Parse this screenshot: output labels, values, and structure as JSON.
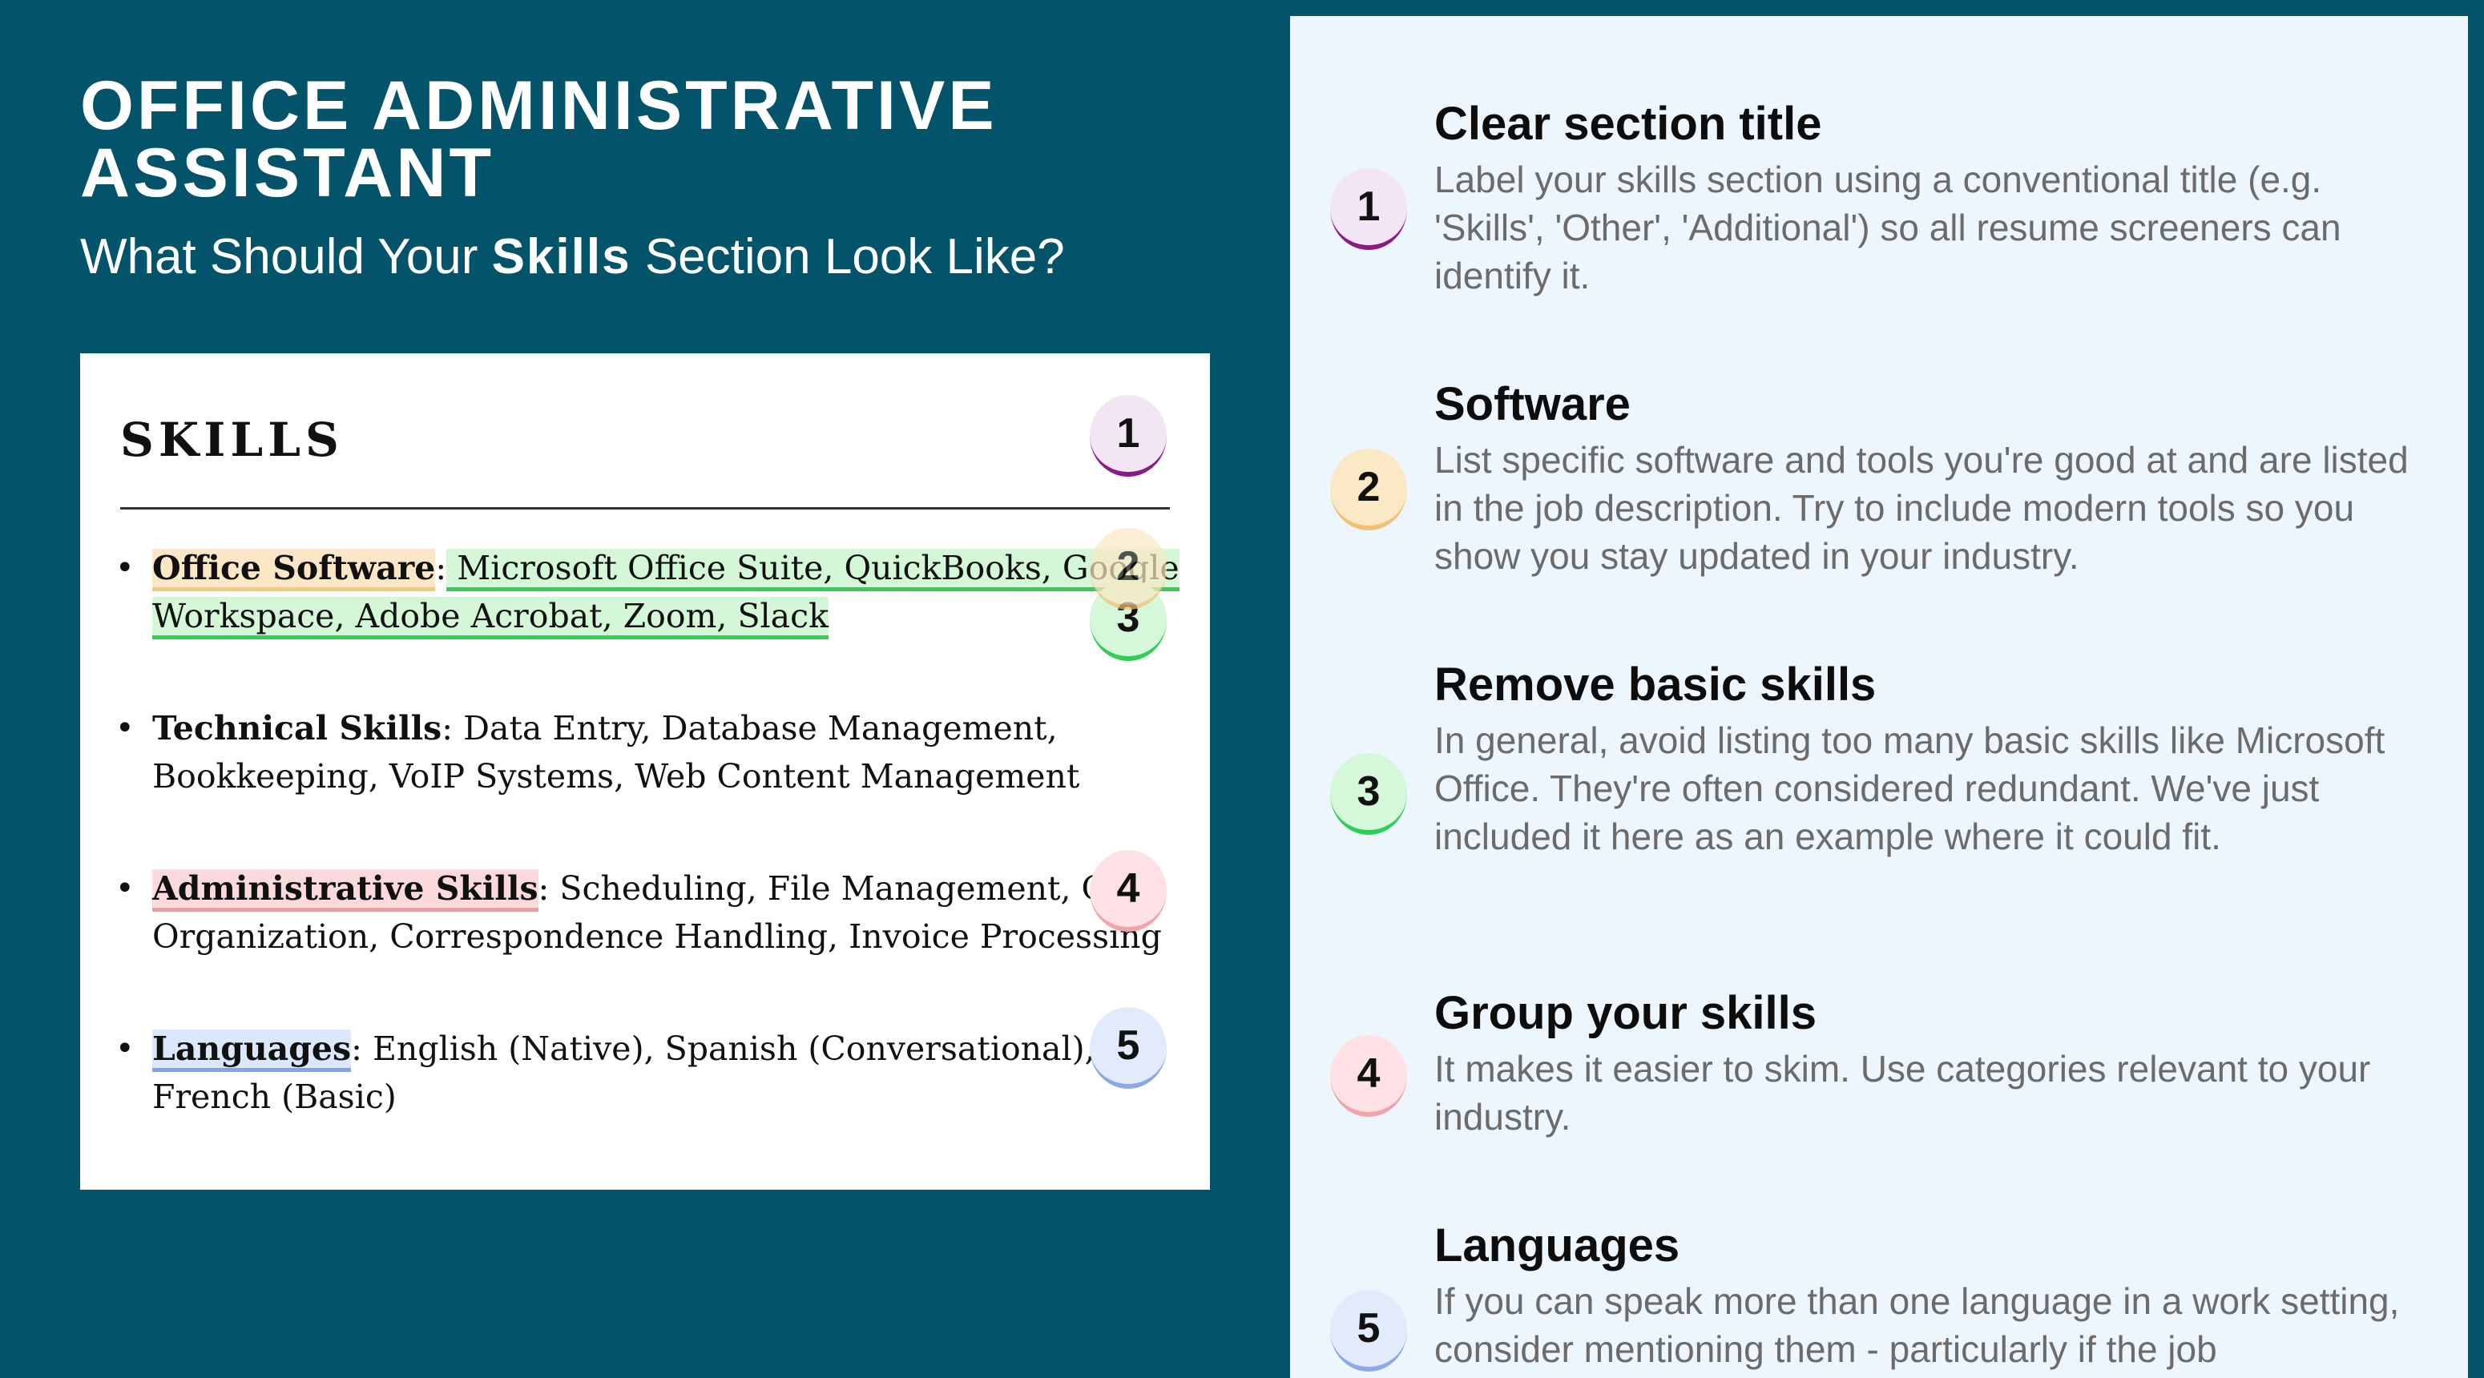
{
  "header": {
    "title_line1": "OFFICE ADMINISTRATIVE",
    "title_line2": "ASSISTANT",
    "subtitle_prefix": "What Should Your ",
    "subtitle_bold": "Skills",
    "subtitle_suffix": " Section Look Like?"
  },
  "card": {
    "heading": "SKILLS",
    "bullet": "•",
    "skills": [
      {
        "category": "Office Software",
        "sep": ":",
        "line1": " Microsoft Office Suite, QuickBooks, Google",
        "line2": "Workspace, Adobe Acrobat, Zoom, Slack"
      },
      {
        "category": "Technical Skills",
        "sep": ":",
        "line1": " Data Entry, Database Management,",
        "line2": "Bookkeeping, VoIP Systems, Web Content Management"
      },
      {
        "category": "Administrative Skills",
        "sep": ":",
        "line1": " Scheduling, File Management, O",
        "line2": "Organization, Correspondence Handling, Invoice Processing"
      },
      {
        "category": "Languages",
        "sep": ":",
        "line1": " English (Native), Spanish (Conversational),",
        "line2": "French (Basic)"
      }
    ]
  },
  "badges": [
    "1",
    "2",
    "3",
    "4",
    "5"
  ],
  "tips": [
    {
      "number": "1",
      "title": "Clear section title",
      "body": "Label your skills section using a conventional title (e.g. 'Skills', 'Other', 'Additional') so all resume screeners can identify it."
    },
    {
      "number": "2",
      "title": "Software",
      "body": "List specific software and tools you're good at and are listed in the job description. Try to include modern tools so you show you stay updated in your industry."
    },
    {
      "number": "3",
      "title": "Remove basic skills",
      "body": "In general, avoid listing too many basic skills like Microsoft Office. They're often considered redundant. We've just included it here as an example where it could fit."
    },
    {
      "number": "4",
      "title": "Group your skills",
      "body": "It makes it easier to skim. Use categories relevant to your industry."
    },
    {
      "number": "5",
      "title": "Languages",
      "body": "If you can speak more than one language in a work setting, consider mentioning them - particularly if the job"
    }
  ],
  "colors": {
    "background": "#03546a",
    "panel": "#eef6fd",
    "badge1": "#8a1a85",
    "badge2": "#f3c070",
    "badge3": "#2ecf55",
    "badge4": "#f3a1ab",
    "badge5": "#8ba9e6"
  }
}
